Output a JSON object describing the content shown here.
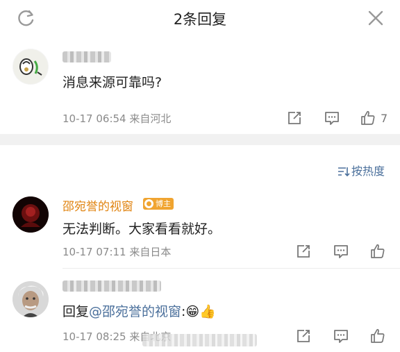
{
  "header": {
    "title": "2条回复"
  },
  "root_comment": {
    "text": "消息来源可靠吗?",
    "meta": "10-17 06:54 来自河北",
    "like_count": "7"
  },
  "sort": {
    "label": "按热度"
  },
  "replies": [
    {
      "name": "邵宛誉的视窗",
      "badge": "博主",
      "text": "无法判断。大家看看就好。",
      "meta": "10-17 07:11 来自日本"
    },
    {
      "prefix": "回复",
      "mention": "@邵宛誉的视窗",
      "suffix": ":😁👍",
      "meta": "10-17 08:25 来自北京"
    }
  ],
  "colors": {
    "mention": "#4a6f9b",
    "username": "#e0830f",
    "badge": "#f0a430"
  }
}
